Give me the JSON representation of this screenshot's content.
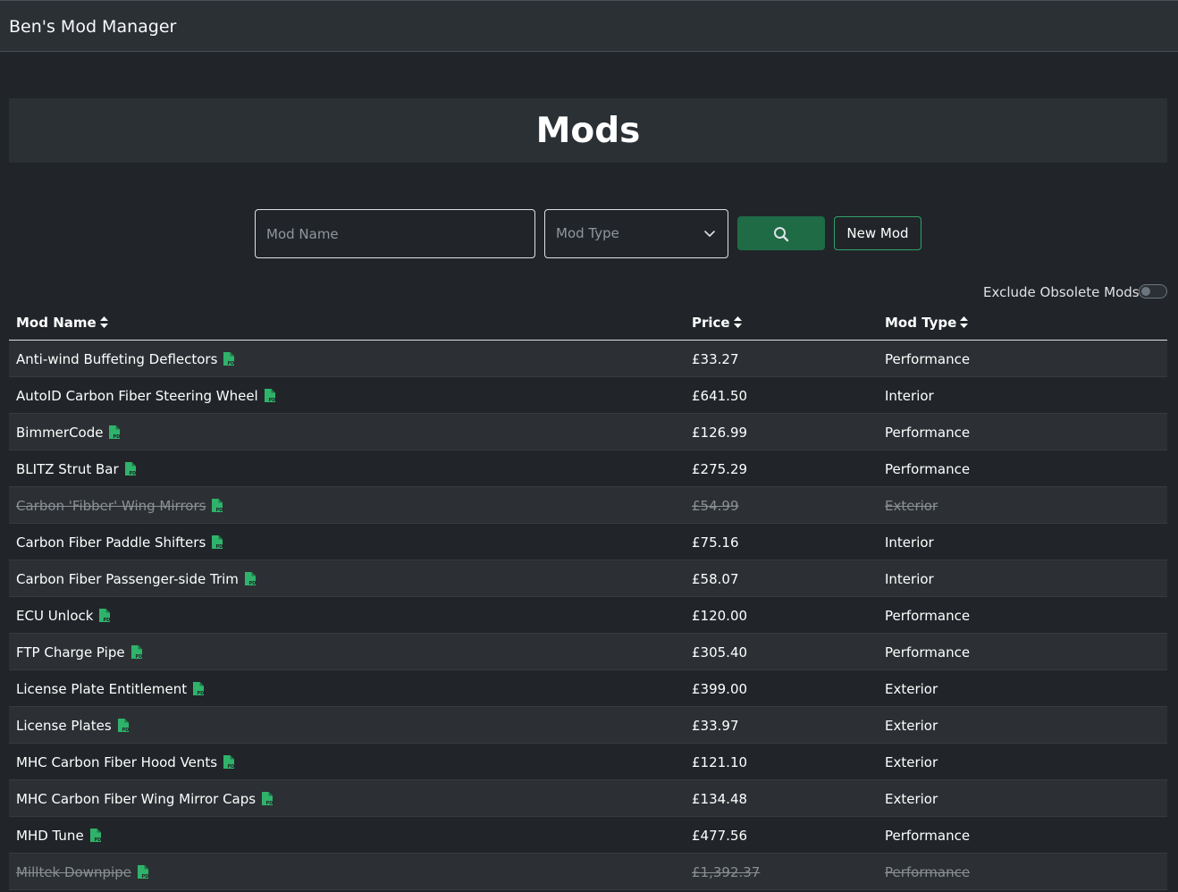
{
  "app": {
    "title": "Ben's Mod Manager"
  },
  "page": {
    "heading": "Mods"
  },
  "filters": {
    "name_placeholder": "Mod Name",
    "type_placeholder": "Mod Type",
    "new_label": "New Mod",
    "exclude_label": "Exclude Obsolete Mods",
    "exclude_enabled": false
  },
  "table": {
    "headers": {
      "name": "Mod Name",
      "price": "Price",
      "type": "Mod Type"
    },
    "rows": [
      {
        "name": "Anti-wind Buffeting Deflectors",
        "price": "£33.27",
        "type": "Performance",
        "obsolete": false
      },
      {
        "name": "AutoID Carbon Fiber Steering Wheel",
        "price": "£641.50",
        "type": "Interior",
        "obsolete": false
      },
      {
        "name": "BimmerCode",
        "price": "£126.99",
        "type": "Performance",
        "obsolete": false
      },
      {
        "name": "BLITZ Strut Bar",
        "price": "£275.29",
        "type": "Performance",
        "obsolete": false
      },
      {
        "name": "Carbon 'Fibber' Wing Mirrors",
        "price": "£54.99",
        "type": "Exterior",
        "obsolete": true
      },
      {
        "name": "Carbon Fiber Paddle Shifters",
        "price": "£75.16",
        "type": "Interior",
        "obsolete": false
      },
      {
        "name": "Carbon Fiber Passenger-side Trim",
        "price": "£58.07",
        "type": "Interior",
        "obsolete": false
      },
      {
        "name": "ECU Unlock",
        "price": "£120.00",
        "type": "Performance",
        "obsolete": false
      },
      {
        "name": "FTP Charge Pipe",
        "price": "£305.40",
        "type": "Performance",
        "obsolete": false
      },
      {
        "name": "License Plate Entitlement",
        "price": "£399.00",
        "type": "Exterior",
        "obsolete": false
      },
      {
        "name": "License Plates",
        "price": "£33.97",
        "type": "Exterior",
        "obsolete": false
      },
      {
        "name": "MHC Carbon Fiber Hood Vents",
        "price": "£121.10",
        "type": "Exterior",
        "obsolete": false
      },
      {
        "name": "MHC Carbon Fiber Wing Mirror Caps",
        "price": "£134.48",
        "type": "Exterior",
        "obsolete": false
      },
      {
        "name": "MHD Tune",
        "price": "£477.56",
        "type": "Performance",
        "obsolete": false
      },
      {
        "name": "Milltek Downpipe",
        "price": "£1,392.37",
        "type": "Performance",
        "obsolete": true
      }
    ]
  },
  "icons": {
    "pdf": "file-pdf-icon",
    "search": "search-icon",
    "sort": "sort-icon",
    "chevron": "chevron-down-icon"
  },
  "colors": {
    "accent": "#2fa36b",
    "button": "#1e6b45",
    "pdf": "#2fb36b",
    "background": "#212529",
    "panel": "#2b3035"
  }
}
